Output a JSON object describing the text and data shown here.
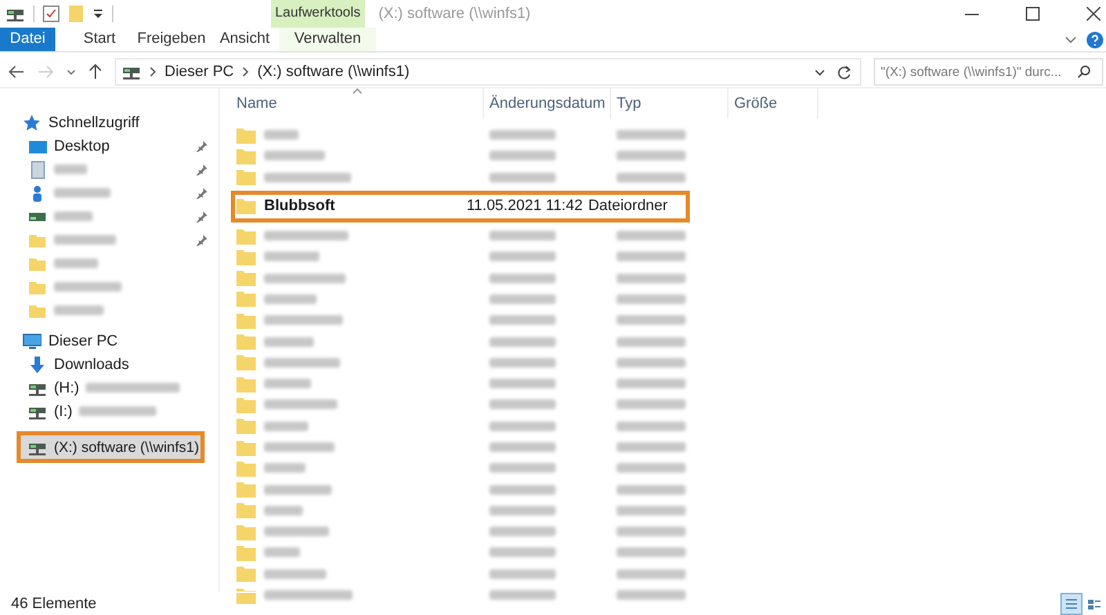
{
  "title_bar": {
    "context_tab": "Laufwerktools",
    "title": "(X:) software (\\\\winfs1)"
  },
  "ribbon_tabs": [
    {
      "label": "Datei",
      "kind": "file"
    },
    {
      "label": "Start",
      "kind": "normal"
    },
    {
      "label": "Freigeben",
      "kind": "normal"
    },
    {
      "label": "Ansicht",
      "kind": "normal"
    },
    {
      "label": "Verwalten",
      "kind": "context"
    }
  ],
  "address_bar": {
    "path": [
      "Dieser PC",
      "(X:) software (\\\\winfs1)"
    ]
  },
  "search": {
    "placeholder": "\"(X:) software (\\\\winfs1)\" durc..."
  },
  "sidebar": {
    "items": [
      {
        "kind": "quick-access",
        "label": "Schnellzugriff"
      },
      {
        "kind": "desktop",
        "label": "Desktop",
        "pinned": true
      },
      {
        "kind": "document",
        "pinned": true
      },
      {
        "kind": "user",
        "pinned": true
      },
      {
        "kind": "drive",
        "pinned": true
      },
      {
        "kind": "folder",
        "pinned": true
      },
      {
        "kind": "folder",
        "pinned": false
      },
      {
        "kind": "folder",
        "pinned": false
      },
      {
        "kind": "folder",
        "pinned": false
      },
      {
        "kind": "pc",
        "label": "Dieser PC"
      },
      {
        "kind": "downloads",
        "label": "Downloads"
      },
      {
        "kind": "network-drive",
        "label": "(H:)"
      },
      {
        "kind": "network-drive",
        "label": "(I:)"
      },
      {
        "kind": "network-drive",
        "label": "(X:) software (\\\\winfs1)",
        "highlighted": true
      }
    ]
  },
  "columns": [
    {
      "label": "Name",
      "sorted": true
    },
    {
      "label": "Änderungsdatum",
      "sorted": false
    },
    {
      "label": "Typ",
      "sorted": false
    },
    {
      "label": "Größe",
      "sorted": false
    }
  ],
  "rows": [
    {
      "highlighted": false
    },
    {
      "highlighted": false
    },
    {
      "highlighted": false
    },
    {
      "name": "Blubbsoft",
      "date": "11.05.2021 11:42",
      "type": "Dateiordner",
      "highlighted": true
    },
    {
      "highlighted": false
    },
    {
      "highlighted": false
    },
    {
      "highlighted": false
    },
    {
      "highlighted": false
    },
    {
      "highlighted": false
    },
    {
      "highlighted": false
    },
    {
      "highlighted": false
    },
    {
      "highlighted": false
    },
    {
      "highlighted": false
    },
    {
      "highlighted": false
    },
    {
      "highlighted": false
    },
    {
      "highlighted": false
    },
    {
      "highlighted": false
    },
    {
      "highlighted": false
    },
    {
      "highlighted": false
    },
    {
      "highlighted": false
    },
    {
      "highlighted": false
    },
    {
      "highlighted": false
    }
  ],
  "status_bar": {
    "count": "46 Elemente"
  },
  "views": [
    {
      "kind": "details",
      "selected": true
    },
    {
      "kind": "tiles",
      "selected": false
    }
  ]
}
